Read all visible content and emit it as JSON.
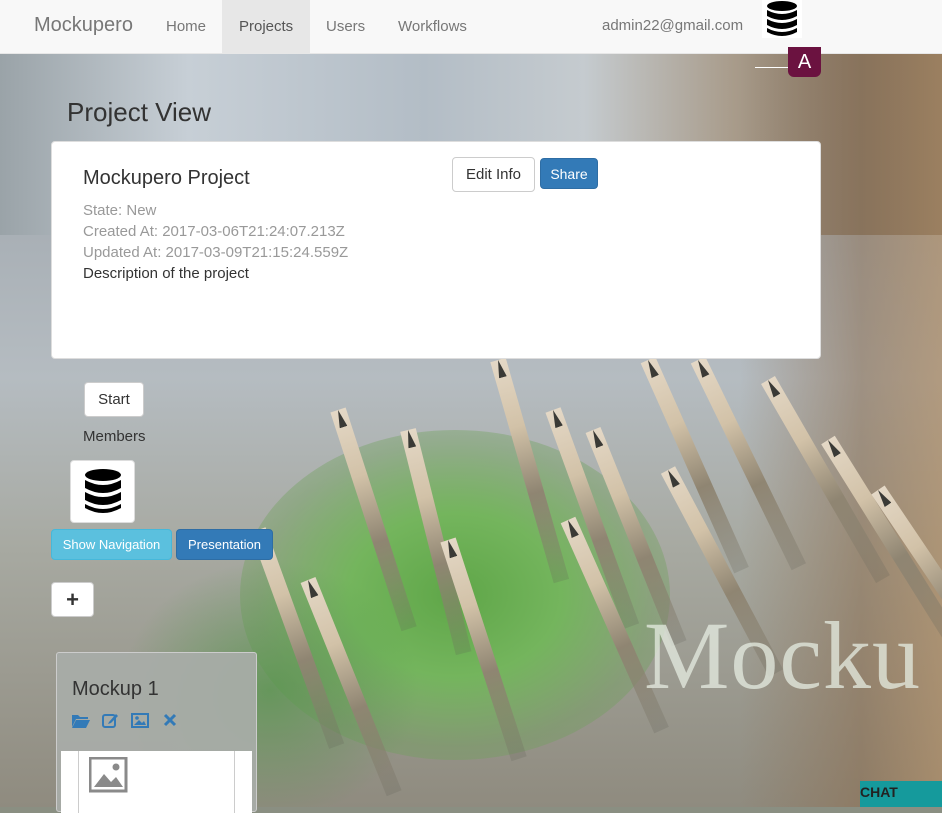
{
  "navbar": {
    "brand": "Mockupero",
    "items": [
      {
        "label": "Home",
        "active": false
      },
      {
        "label": "Projects",
        "active": true
      },
      {
        "label": "Users",
        "active": false
      },
      {
        "label": "Workflows",
        "active": false
      }
    ],
    "user_email": "admin22@gmail.com",
    "user_icon": "database-icon",
    "avatar_letter": "A",
    "avatar_color": "#6b1240"
  },
  "page": {
    "title": "Project View"
  },
  "project": {
    "name": "Mockupero Project",
    "state": "State: New",
    "created": "Created At: 2017-03-06T21:24:07.213Z",
    "updated": "Updated At: 2017-03-09T21:15:24.559Z",
    "description": "Description of the project",
    "edit_label": "Edit Info",
    "share_label": "Share"
  },
  "actions": {
    "start_label": "Start",
    "members_label": "Members",
    "member_icon": "database-icon",
    "show_navigation_label": "Show Navigation",
    "presentation_label": "Presentation",
    "add_label": "+"
  },
  "mockups": [
    {
      "title": "Mockup 1",
      "tools": [
        "folder-open-icon",
        "edit-icon",
        "image-icon",
        "remove-icon"
      ],
      "thumbnail_icon": "image-placeholder-icon"
    }
  ],
  "background": {
    "watermark_text": "Mocku"
  },
  "chat": {
    "label": "CHAT",
    "color": "#159a9c"
  },
  "colors": {
    "primary": "#337ab7",
    "info": "#5bc0de",
    "tool_icon": "#337ab7"
  }
}
